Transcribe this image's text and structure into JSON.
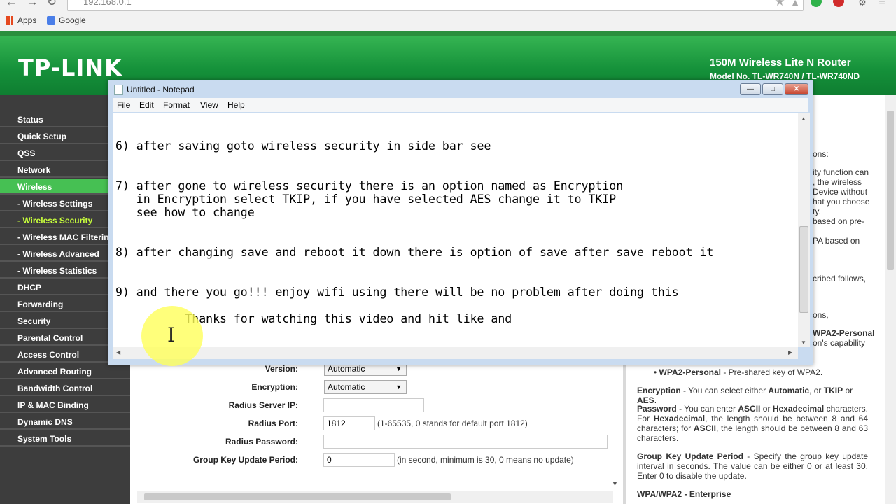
{
  "browser": {
    "url": "192.168.0.1",
    "bookmarks": [
      {
        "label": "Apps",
        "icon": "apps-grid-icon"
      },
      {
        "label": "Google",
        "icon": "google-icon"
      }
    ],
    "colors": {
      "apps_icon": "#e5491f",
      "google_icon": "#4a7ee8"
    }
  },
  "router": {
    "logo": "TP-LINK",
    "product": "150M Wireless Lite N Router",
    "model": "Model No. TL-WR740N / TL-WR740ND",
    "brand_color": "#1c9b3e",
    "menu": [
      {
        "label": "Status"
      },
      {
        "label": "Quick Setup"
      },
      {
        "label": "QSS"
      },
      {
        "label": "Network"
      },
      {
        "label": "Wireless",
        "active": true
      },
      {
        "label": "- Wireless Settings"
      },
      {
        "label": "- Wireless Security",
        "selected": true
      },
      {
        "label": "- Wireless MAC Filtering"
      },
      {
        "label": "- Wireless Advanced"
      },
      {
        "label": "- Wireless Statistics"
      },
      {
        "label": "DHCP"
      },
      {
        "label": "Forwarding"
      },
      {
        "label": "Security"
      },
      {
        "label": "Parental Control"
      },
      {
        "label": "Access Control"
      },
      {
        "label": "Advanced Routing"
      },
      {
        "label": "Bandwidth Control"
      },
      {
        "label": "IP & MAC Binding"
      },
      {
        "label": "Dynamic DNS"
      },
      {
        "label": "System Tools"
      }
    ],
    "form": {
      "version_label": "Version:",
      "version_value": "Automatic",
      "encryption_label": "Encryption:",
      "encryption_value": "Automatic",
      "radius_ip_label": "Radius Server IP:",
      "radius_ip_value": "",
      "radius_port_label": "Radius Port:",
      "radius_port_value": "1812",
      "radius_port_note": "(1-65535, 0 stands for default port 1812)",
      "radius_password_label": "Radius Password:",
      "radius_password_value": "",
      "group_key_label": "Group Key Update Period:",
      "group_key_value": "0",
      "group_key_note": "(in second, minimum is 30, 0 means no update)"
    },
    "help": {
      "fragments": [
        "ons:",
        "ity function can",
        ", the wireless",
        "Device without",
        "hat you choose",
        "ty.",
        "based on pre-",
        "PA based on",
        "cribed follows,",
        "ons,",
        "WPA2-Personal",
        "on's capability"
      ],
      "wpa2_personal_term": "WPA2-Personal",
      "wpa2_personal_desc": " - Pre-shared key of WPA2.",
      "encryption_term": "Encryption",
      "encryption_desc_1": " - You can select either ",
      "encryption_opt_auto": "Automatic",
      "encryption_desc_2": ", or ",
      "encryption_opt_tkip": "TKIP",
      "encryption_desc_3": " or ",
      "encryption_opt_aes": "AES",
      "encryption_desc_4": ".",
      "password_term": "Password",
      "password_desc_1": " - You can enter ",
      "password_ascii": "ASCII",
      "password_desc_2": " or ",
      "password_hex": "Hexadecimal",
      "password_desc_3": " characters. For ",
      "password_hex2": "Hexadecimal",
      "password_desc_4": ", the length should be between 8 and 64 characters; for ",
      "password_ascii2": "ASCII",
      "password_desc_5": ", the length should be between 8 and 63 characters.",
      "gkup_term": "Group Key Update Period",
      "gkup_desc": " - Specify the group key update interval in seconds. The value can be either 0 or at least 30. Enter 0 to disable the update.",
      "wpa_enterprise_heading": "WPA/WPA2 - Enterprise"
    }
  },
  "notepad": {
    "title": "Untitled - Notepad",
    "menu": [
      "File",
      "Edit",
      "Format",
      "View",
      "Help"
    ],
    "lines": [
      "6) after saving goto wireless security in side bar see",
      "7) after gone to wireless security there is an option named as Encryption",
      "   in Encryption select TKIP, if you have selected AES change it to TKIP",
      "   see how to change",
      "8) after changing save and reboot it down there is option of save after save reboot it",
      "9) and there you go!!! enjoy wifi using there will be no problem after doing this",
      "          Thanks for watching this video and hit like and"
    ]
  }
}
